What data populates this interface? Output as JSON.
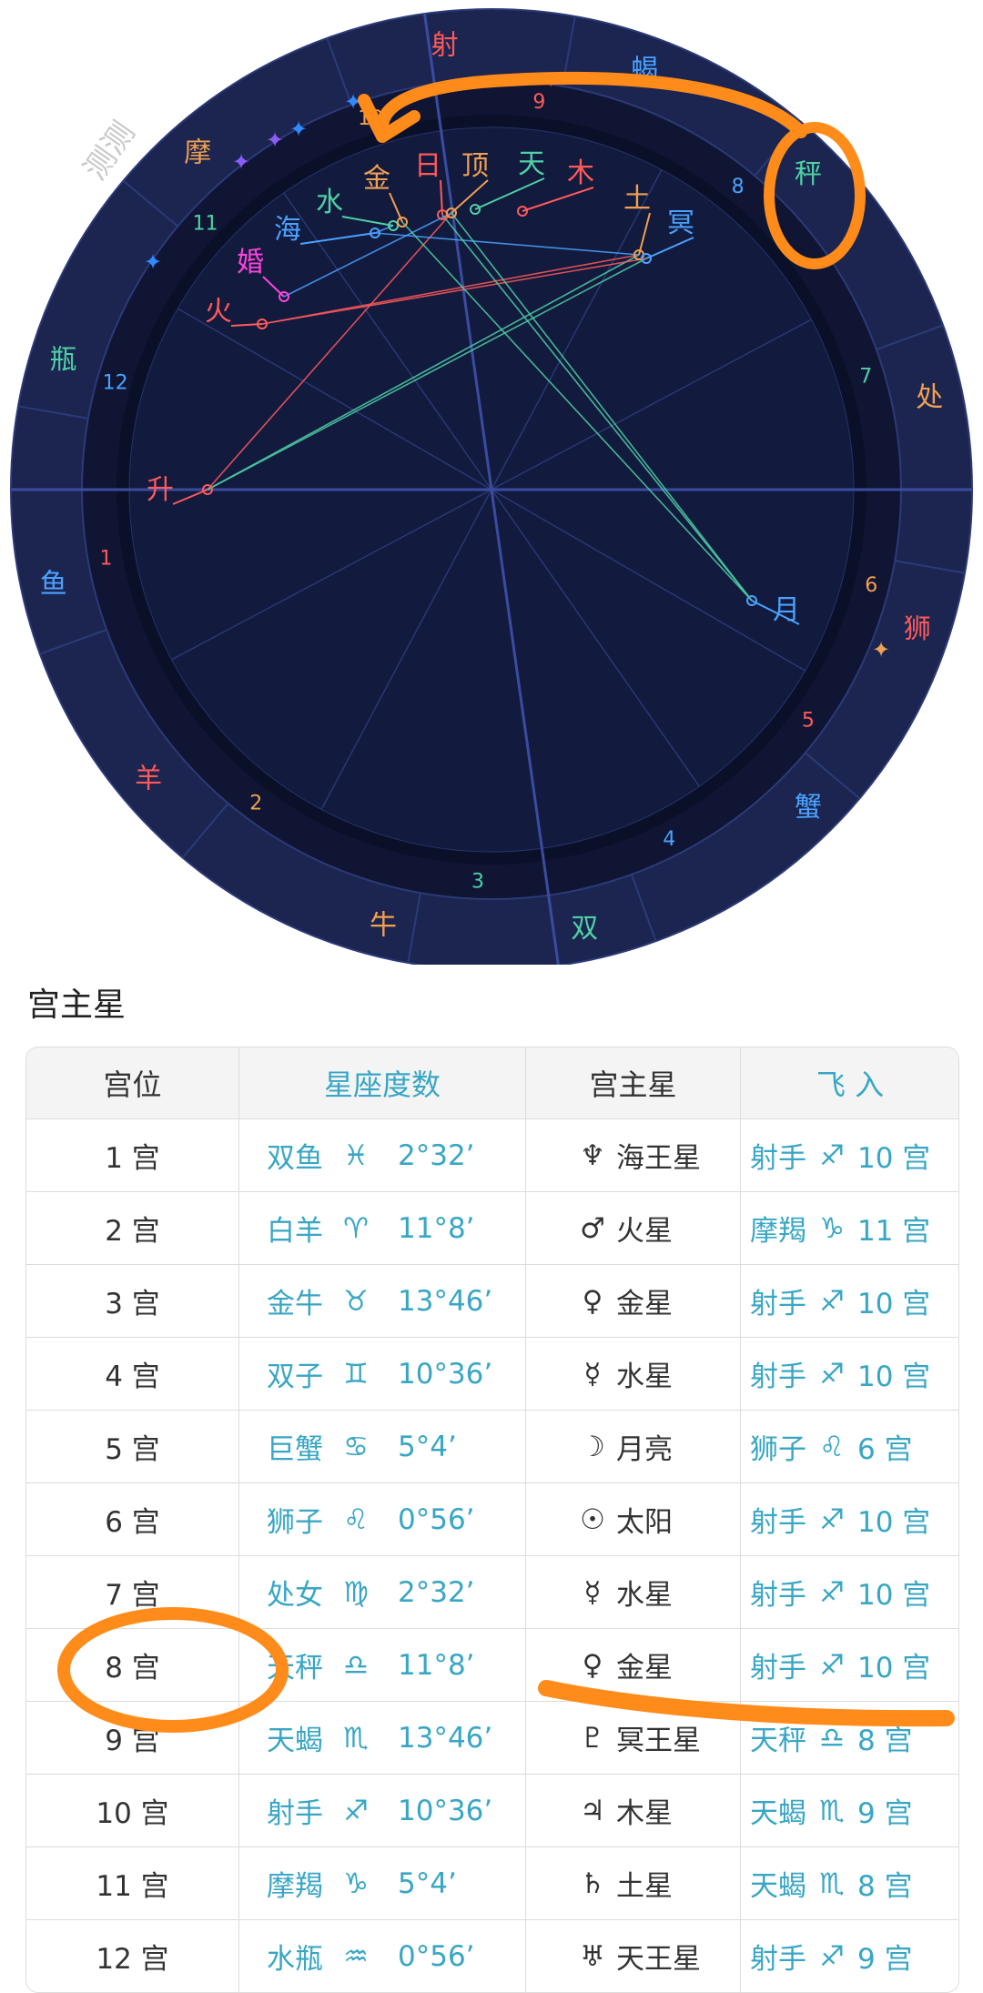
{
  "chart": {
    "watermark": "测测",
    "zodiac": [
      {
        "name": "射",
        "angle": 96,
        "color": "#ff5a5a"
      },
      {
        "name": "蝎",
        "angle": 70,
        "color": "#4aa3ff"
      },
      {
        "name": "秤",
        "angle": 45,
        "color": "#4fd1a5"
      },
      {
        "name": "处",
        "angle": 12,
        "color": "#f0a050"
      },
      {
        "name": "狮",
        "angle": -18,
        "color": "#ff5a5a"
      },
      {
        "name": "蟹",
        "angle": -45,
        "color": "#4aa3ff"
      },
      {
        "name": "双",
        "angle": -78,
        "color": "#4fd1a5"
      },
      {
        "name": "牛",
        "angle": -104,
        "color": "#f0a050"
      },
      {
        "name": "羊",
        "angle": -140,
        "color": "#ff5a5a"
      },
      {
        "name": "鱼",
        "angle": -168,
        "color": "#4aa3ff"
      },
      {
        "name": "瓶",
        "angle": 163,
        "color": "#4fd1a5"
      },
      {
        "name": "摩",
        "angle": 131,
        "color": "#f0a050"
      }
    ],
    "houses": [
      {
        "num": "1",
        "angle": -170,
        "color": "#ff5a5a"
      },
      {
        "num": "2",
        "angle": -127,
        "color": "#f0a050"
      },
      {
        "num": "3",
        "angle": -92,
        "color": "#4fd1a5"
      },
      {
        "num": "4",
        "angle": -63,
        "color": "#4aa3ff"
      },
      {
        "num": "5",
        "angle": -36,
        "color": "#ff5a5a"
      },
      {
        "num": "6",
        "angle": -14,
        "color": "#f0a050"
      },
      {
        "num": "7",
        "angle": 17,
        "color": "#4fd1a5"
      },
      {
        "num": "8",
        "angle": 51,
        "color": "#4aa3ff"
      },
      {
        "num": "9",
        "angle": 83,
        "color": "#ff5a5a"
      },
      {
        "num": "10",
        "angle": 108,
        "color": "#f0a050"
      },
      {
        "num": "11",
        "angle": 137,
        "color": "#4fd1a5"
      },
      {
        "num": "12",
        "angle": 164,
        "color": "#4aa3ff"
      }
    ],
    "planets": [
      {
        "name": "升",
        "color": "#ff5a5a"
      },
      {
        "name": "火",
        "color": "#ff5a5a"
      },
      {
        "name": "婚",
        "color": "#ff44dd"
      },
      {
        "name": "海",
        "color": "#4aa3ff"
      },
      {
        "name": "水",
        "color": "#4fd1a5"
      },
      {
        "name": "金",
        "color": "#f0a050"
      },
      {
        "name": "日",
        "color": "#ff5a5a"
      },
      {
        "name": "顶",
        "color": "#f0a050"
      },
      {
        "name": "天",
        "color": "#4fd1a5"
      },
      {
        "name": "木",
        "color": "#ff5a5a"
      },
      {
        "name": "土",
        "color": "#f0a050"
      },
      {
        "name": "冥",
        "color": "#4aa3ff"
      },
      {
        "name": "月",
        "color": "#4aa3ff"
      }
    ]
  },
  "section_title": "宫主星",
  "table": {
    "headers": [
      "宫位",
      "星座度数",
      "宫主星",
      "飞 入"
    ],
    "rows": [
      {
        "house": "1 宫",
        "sign": "双鱼",
        "sign_glyph": "♓",
        "degree": "2°32’",
        "ruler_glyph": "♆",
        "ruler": "海王星",
        "fly_sign": "射手",
        "fly_glyph": "♐",
        "fly_house": "10 宫"
      },
      {
        "house": "2 宫",
        "sign": "白羊",
        "sign_glyph": "♈",
        "degree": "11°8’",
        "ruler_glyph": "♂",
        "ruler": "火星",
        "fly_sign": "摩羯",
        "fly_glyph": "♑",
        "fly_house": "11 宫"
      },
      {
        "house": "3 宫",
        "sign": "金牛",
        "sign_glyph": "♉",
        "degree": "13°46’",
        "ruler_glyph": "♀",
        "ruler": "金星",
        "fly_sign": "射手",
        "fly_glyph": "♐",
        "fly_house": "10 宫"
      },
      {
        "house": "4 宫",
        "sign": "双子",
        "sign_glyph": "♊",
        "degree": "10°36’",
        "ruler_glyph": "☿",
        "ruler": "水星",
        "fly_sign": "射手",
        "fly_glyph": "♐",
        "fly_house": "10 宫"
      },
      {
        "house": "5 宫",
        "sign": "巨蟹",
        "sign_glyph": "♋",
        "degree": "5°4’",
        "ruler_glyph": "☽",
        "ruler": "月亮",
        "fly_sign": "狮子",
        "fly_glyph": "♌",
        "fly_house": "6 宫"
      },
      {
        "house": "6 宫",
        "sign": "狮子",
        "sign_glyph": "♌",
        "degree": "0°56’",
        "ruler_glyph": "☉",
        "ruler": "太阳",
        "fly_sign": "射手",
        "fly_glyph": "♐",
        "fly_house": "10 宫"
      },
      {
        "house": "7 宫",
        "sign": "处女",
        "sign_glyph": "♍",
        "degree": "2°32’",
        "ruler_glyph": "☿",
        "ruler": "水星",
        "fly_sign": "射手",
        "fly_glyph": "♐",
        "fly_house": "10 宫"
      },
      {
        "house": "8 宫",
        "sign": "天秤",
        "sign_glyph": "♎",
        "degree": "11°8’",
        "ruler_glyph": "♀",
        "ruler": "金星",
        "fly_sign": "射手",
        "fly_glyph": "♐",
        "fly_house": "10 宫"
      },
      {
        "house": "9 宫",
        "sign": "天蝎",
        "sign_glyph": "♏",
        "degree": "13°46’",
        "ruler_glyph": "♇",
        "ruler": "冥王星",
        "fly_sign": "天秤",
        "fly_glyph": "♎",
        "fly_house": "8 宫"
      },
      {
        "house": "10 宫",
        "sign": "射手",
        "sign_glyph": "♐",
        "degree": "10°36’",
        "ruler_glyph": "♃",
        "ruler": "木星",
        "fly_sign": "天蝎",
        "fly_glyph": "♏",
        "fly_house": "9 宫"
      },
      {
        "house": "11 宫",
        "sign": "摩羯",
        "sign_glyph": "♑",
        "degree": "5°4’",
        "ruler_glyph": "♄",
        "ruler": "土星",
        "fly_sign": "天蝎",
        "fly_glyph": "♏",
        "fly_house": "8 宫"
      },
      {
        "house": "12 宫",
        "sign": "水瓶",
        "sign_glyph": "♒",
        "degree": "0°56’",
        "ruler_glyph": "♅",
        "ruler": "天王星",
        "fly_sign": "射手",
        "fly_glyph": "♐",
        "fly_house": "9 宫"
      }
    ]
  },
  "colors": {
    "chart_bg": "#1b2550",
    "chart_ring": "#0f1533",
    "accent_text": "#38a6c4",
    "annotation": "#ff8c1a"
  }
}
